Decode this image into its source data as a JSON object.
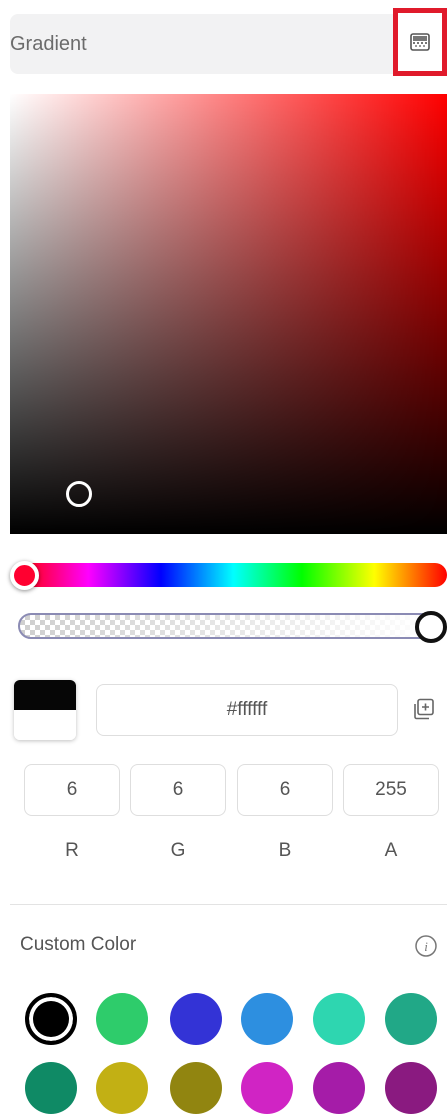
{
  "header": {
    "mode_label": "Gradient",
    "mode_icon": "gradient-mode-icon"
  },
  "picker": {
    "base_hue_color": "#ff0000",
    "hue_thumb_color": "#ff0030",
    "alpha_level": 1.0
  },
  "hex": {
    "value": "#ffffff"
  },
  "channels": [
    {
      "label": "R",
      "value": "6"
    },
    {
      "label": "G",
      "value": "6"
    },
    {
      "label": "B",
      "value": "6"
    },
    {
      "label": "A",
      "value": "255"
    }
  ],
  "custom": {
    "label": "Custom Color",
    "info_icon": "info-icon",
    "swatches": [
      "#000000",
      "#2ecc6b",
      "#3333d6",
      "#2d8fe0",
      "#2ed6b0",
      "#21a887",
      "#0f8a65",
      "#c2b014",
      "#918510",
      "#d024c4",
      "#a51ca8",
      "#8a1a80"
    ]
  }
}
